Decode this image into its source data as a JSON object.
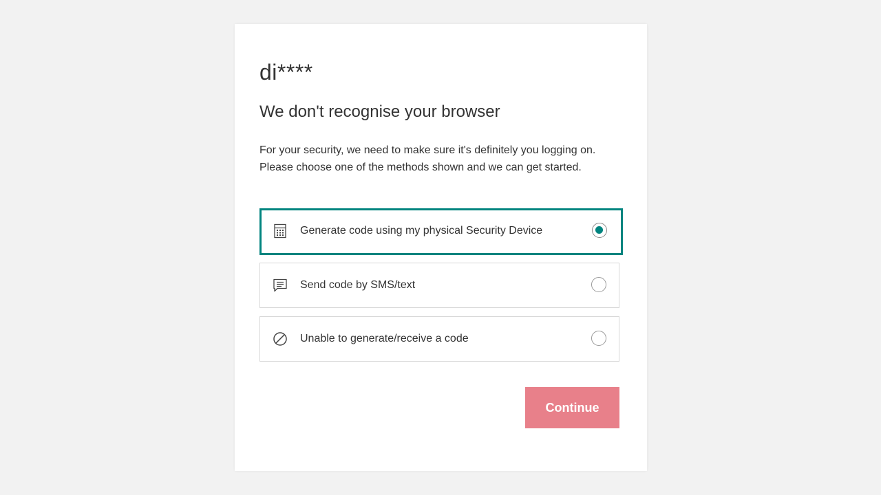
{
  "account": {
    "masked_username": "di****"
  },
  "page": {
    "heading": "We don't recognise your browser",
    "intro": "For your security, we need to make sure it's definitely you logging on. Please choose one of the methods shown and we can get started."
  },
  "options": [
    {
      "label": "Generate code using my physical Security Device",
      "icon": "calculator-icon",
      "selected": true
    },
    {
      "label": "Send code by SMS/text",
      "icon": "message-icon",
      "selected": false
    },
    {
      "label": "Unable to generate/receive a code",
      "icon": "prohibited-icon",
      "selected": false
    }
  ],
  "actions": {
    "continue_label": "Continue"
  },
  "colors": {
    "accent": "#00847f",
    "continue_button": "#e8808a",
    "background": "#f2f2f2"
  }
}
